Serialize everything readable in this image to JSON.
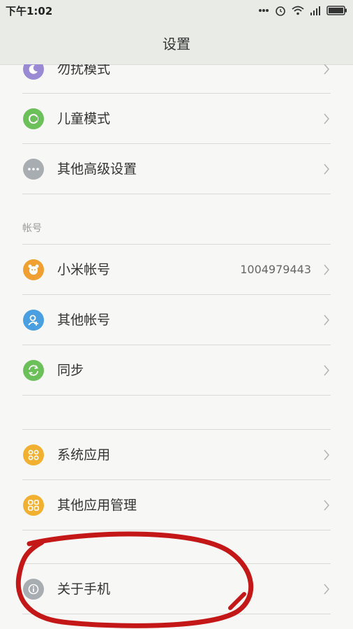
{
  "status_bar": {
    "time": "下午1:02",
    "icons": [
      "more-dots-icon",
      "alarm-icon",
      "wifi-icon",
      "signal-icon",
      "battery-icon"
    ]
  },
  "header": {
    "title": "设置"
  },
  "groups": [
    {
      "items": [
        {
          "label": "勿扰模式",
          "icon": "moon-icon",
          "icon_color": "#9a8ad4"
        },
        {
          "label": "儿童模式",
          "icon": "kid-icon",
          "icon_color": "#6cc05a"
        },
        {
          "label": "其他高级设置",
          "icon": "more-dots-icon",
          "icon_color": "#a8adb2"
        }
      ]
    },
    {
      "header": "帐号",
      "items": [
        {
          "label": "小米帐号",
          "value": "1004979443",
          "icon": "mi-bear-icon",
          "icon_color": "#f0a030"
        },
        {
          "label": "其他帐号",
          "icon": "add-user-icon",
          "icon_color": "#4a9fe0"
        },
        {
          "label": "同步",
          "icon": "sync-icon",
          "icon_color": "#6cc05a"
        }
      ]
    },
    {
      "items": [
        {
          "label": "系统应用",
          "icon": "apps-grid-icon",
          "icon_color": "#f2b030"
        },
        {
          "label": "其他应用管理",
          "icon": "apps-grid-icon",
          "icon_color": "#f2b030"
        }
      ]
    },
    {
      "items": [
        {
          "label": "关于手机",
          "icon": "info-icon",
          "icon_color": "#a8adb2"
        }
      ]
    }
  ],
  "annotation_color": "#c41818"
}
